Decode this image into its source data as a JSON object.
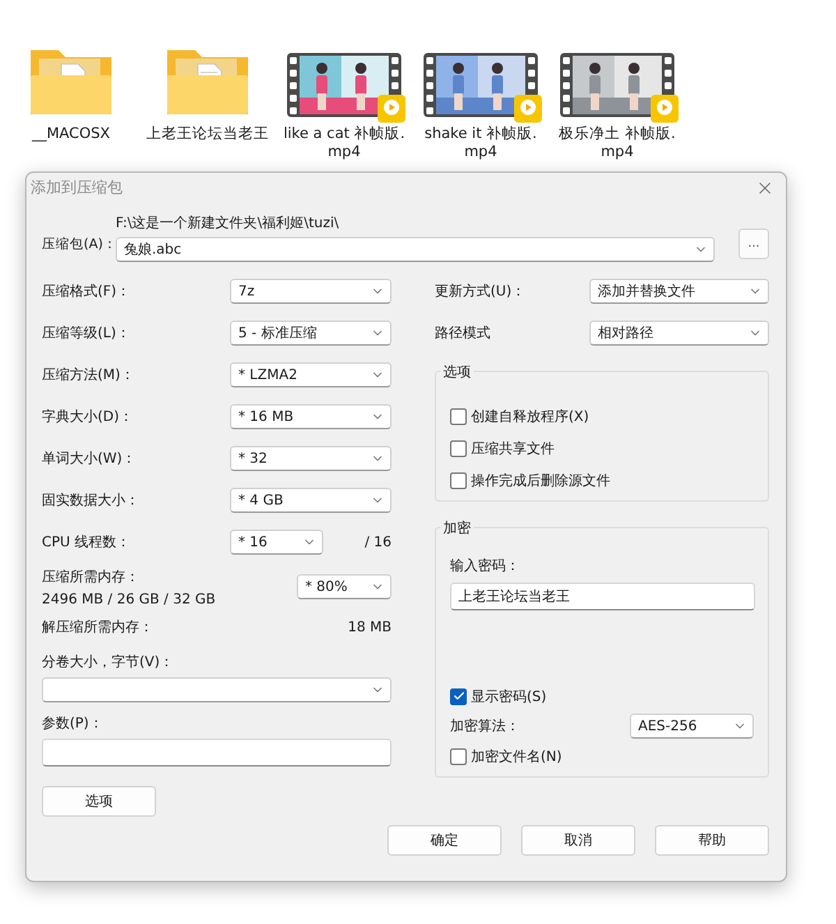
{
  "desktop_items": [
    {
      "name": "__MACOSX",
      "kind": "folder"
    },
    {
      "name": "上老王论坛当老王",
      "kind": "folder"
    },
    {
      "name": "like a cat 补帧版.mp4",
      "kind": "video"
    },
    {
      "name": "shake it 补帧版.mp4",
      "kind": "video"
    },
    {
      "name": "极乐净土 补帧版.mp4",
      "kind": "video"
    }
  ],
  "dialog": {
    "title": "添加到压缩包",
    "archive": {
      "label": "压缩包(A)：",
      "path": "F:\\这是一个新建文件夹\\福利姬\\tuzi\\",
      "filename": "兔娘.abc"
    },
    "browse_button": "...",
    "left": [
      {
        "kind": "select",
        "label": "压缩格式(F)：",
        "value": "7z"
      },
      {
        "kind": "select",
        "label": "压缩等级(L)：",
        "value": "5 - 标准压缩"
      },
      {
        "kind": "select",
        "label": "压缩方法(M)：",
        "value": "*  LZMA2"
      },
      {
        "kind": "select",
        "label": "字典大小(D)：",
        "value": "*  16 MB"
      },
      {
        "kind": "select",
        "label": "单词大小(W)：",
        "value": "*  32"
      },
      {
        "kind": "select",
        "label": "固实数据大小：",
        "value": "*  4 GB"
      },
      {
        "kind": "threads",
        "label": "CPU 线程数：",
        "value": "*  16",
        "suffix": "/ 16"
      },
      {
        "kind": "memory",
        "label": "压缩所需内存：",
        "detail": "2496 MB / 26 GB / 32 GB",
        "value": "*  80%"
      },
      {
        "kind": "reading",
        "label": "解压缩所需内存：",
        "value": "18 MB"
      },
      {
        "kind": "volume",
        "label": "分卷大小，字节(V)："
      },
      {
        "kind": "params",
        "label": "参数(P)："
      }
    ],
    "options_button": "选项",
    "right": [
      {
        "label": "更新方式(U)：",
        "value": "添加并替换文件"
      },
      {
        "label": "路径模式",
        "value": "相对路径"
      }
    ],
    "options_group": {
      "title": "选项",
      "items": [
        {
          "label": "创建自释放程序(X)",
          "checked": false
        },
        {
          "label": "压缩共享文件",
          "checked": false
        },
        {
          "label": "操作完成后删除源文件",
          "checked": false
        }
      ]
    },
    "encryption": {
      "title": "加密",
      "password_label": "输入密码：",
      "password": "上老王论坛当老王",
      "show_password": {
        "label": "显示密码(S)",
        "checked": true
      },
      "algorithm_label": "加密算法：",
      "algorithm": "AES-256",
      "encrypt_names": {
        "label": "加密文件名(N)",
        "checked": false
      }
    },
    "buttons": [
      "确定",
      "取消",
      "帮助"
    ]
  }
}
